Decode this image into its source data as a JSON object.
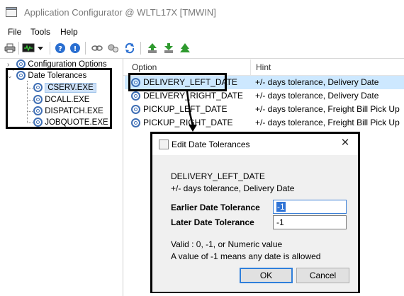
{
  "window": {
    "title": "Application Configurator @ WLTL17X [TMWIN]"
  },
  "menu": {
    "items": [
      "File",
      "Tools",
      "Help"
    ]
  },
  "toolbar": {
    "icons": [
      "printer-icon",
      "monitor-icon",
      "dropdown-arrow-icon",
      "help-icon",
      "info-icon",
      "link-icon",
      "gears-icon",
      "refresh-icon",
      "upload-icon",
      "download-icon",
      "tree-icon"
    ]
  },
  "tree": {
    "root_items": [
      {
        "label": "Configuration Options",
        "expanded": false
      },
      {
        "label": "Date Tolerances",
        "expanded": true
      }
    ],
    "children": [
      {
        "label": "CSERV.EXE",
        "selected": true
      },
      {
        "label": "DCALL.EXE"
      },
      {
        "label": "DISPATCH.EXE"
      },
      {
        "label": "JOBQUOTE.EXE"
      }
    ]
  },
  "list": {
    "columns": [
      "Option",
      "Hint"
    ],
    "rows": [
      {
        "option": "DELIVERY_LEFT_DATE",
        "hint": "+/- days tolerance, Delivery Date",
        "selected": true
      },
      {
        "option": "DELIVERY_RIGHT_DATE",
        "hint": "+/- days tolerance, Delivery Date"
      },
      {
        "option": "PICKUP_LEFT_DATE",
        "hint": "+/- days tolerance, Freight Bill Pick Up"
      },
      {
        "option": "PICKUP_RIGHT_DATE",
        "hint": "+/- days tolerance, Freight Bill Pick Up"
      }
    ]
  },
  "dialog": {
    "title": "Edit Date Tolerances",
    "option_name": "DELIVERY_LEFT_DATE",
    "option_hint": "+/- days tolerance, Delivery Date",
    "earlier_label": "Earlier Date Tolerance",
    "earlier_value": "-1",
    "later_label": "Later Date Tolerance",
    "later_value": "-1",
    "valid_text": "Valid   : 0, -1, or Numeric value",
    "note_text": "A value of -1 means any date is allowed",
    "ok_label": "OK",
    "cancel_label": "Cancel"
  },
  "colors": {
    "selection": "#cde8ff",
    "annotation_border": "#000000",
    "gear_blue": "#3f6fb5"
  }
}
